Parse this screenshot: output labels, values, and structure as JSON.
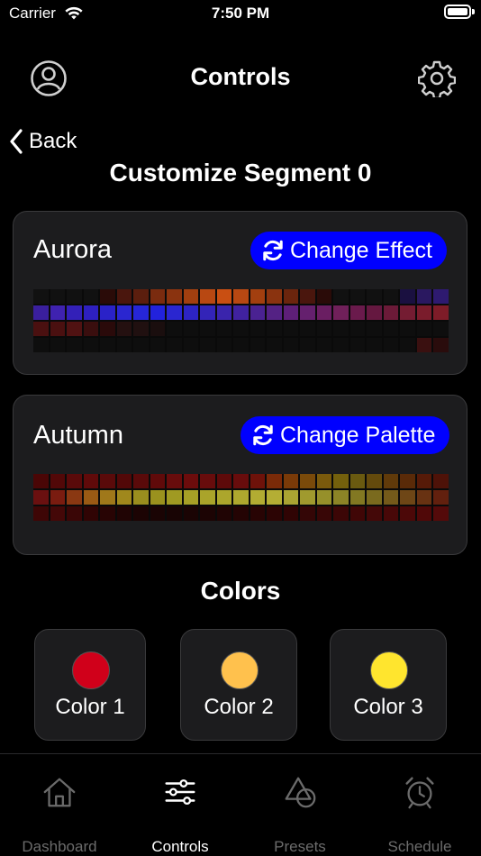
{
  "status": {
    "carrier": "Carrier",
    "time": "7:50 PM"
  },
  "nav": {
    "title": "Controls",
    "back_label": "Back"
  },
  "page": {
    "title": "Customize Segment 0"
  },
  "effect_card": {
    "name": "Aurora",
    "button_label": "Change Effect",
    "rows": [
      [
        "#111",
        "#111",
        "#111",
        "#111",
        "#2a0b08",
        "#4a160d",
        "#5b1e0e",
        "#7a2b0f",
        "#8a330f",
        "#a23f0f",
        "#b84812",
        "#c94f12",
        "#b84812",
        "#a23f0f",
        "#8a330f",
        "#6b250d",
        "#4a160d",
        "#2a0b08",
        "#111",
        "#111",
        "#111",
        "#111",
        "#1a1040",
        "#2a1860",
        "#2e1a70"
      ],
      [
        "#3a1f9e",
        "#3f22b0",
        "#3320b8",
        "#2e20c0",
        "#2a22c8",
        "#2a26d0",
        "#2626d8",
        "#2222dc",
        "#2a26d0",
        "#2d24c4",
        "#3324b8",
        "#3a24ac",
        "#4022a0",
        "#4a2292",
        "#542284",
        "#5e1f78",
        "#65206e",
        "#6a1e62",
        "#70205a",
        "#6a1a4c",
        "#651840",
        "#6b1a38",
        "#741c32",
        "#7a1c2c",
        "#7e1c28"
      ],
      [
        "#4a1010",
        "#4a1010",
        "#501212",
        "#3a0e0e",
        "#2a0a0a",
        "#241010",
        "#201010",
        "#1a0e0e",
        "#0e0e0e",
        "#0e0e0e",
        "#0e0e0e",
        "#0e0e0e",
        "#0e0e0e",
        "#0e0e0e",
        "#0e0e0e",
        "#0e0e0e",
        "#0e0e0e",
        "#0e0e0e",
        "#0e0e0e",
        "#0e0e0e",
        "#0e0e0e",
        "#0e0e0e",
        "#0e0e0e",
        "#0e0e0e",
        "#0e0e0e"
      ],
      [
        "#0e0e0e",
        "#0e0e0e",
        "#0e0e0e",
        "#0e0e0e",
        "#0e0e0e",
        "#0e0e0e",
        "#0e0e0e",
        "#0e0e0e",
        "#0e0e0e",
        "#0e0e0e",
        "#0e0e0e",
        "#0e0e0e",
        "#0e0e0e",
        "#0e0e0e",
        "#0e0e0e",
        "#0e0e0e",
        "#0e0e0e",
        "#0e0e0e",
        "#0e0e0e",
        "#0e0e0e",
        "#0e0e0e",
        "#0e0e0e",
        "#0e0e0e",
        "#3a1010",
        "#2a0c0c"
      ]
    ]
  },
  "palette_card": {
    "name": "Autumn",
    "button_label": "Change Palette",
    "rows": [
      [
        "#4a0606",
        "#520808",
        "#5a0a0a",
        "#600a0a",
        "#5a0a0a",
        "#520808",
        "#5a0a0a",
        "#600a0a",
        "#680c0c",
        "#6c0c0c",
        "#680c0c",
        "#5e0a0a",
        "#680c0c",
        "#6e120a",
        "#7a2a08",
        "#7a3a08",
        "#7a4a0a",
        "#7a5a0c",
        "#74600c",
        "#6a5a10",
        "#644a0c",
        "#603a0a",
        "#5a2a08",
        "#561a08",
        "#4e1208"
      ],
      [
        "#6a1010",
        "#7a1c10",
        "#8a3812",
        "#9a5a14",
        "#a0781a",
        "#a0881c",
        "#9a8e1e",
        "#9a921e",
        "#a09a22",
        "#a6a026",
        "#aaa42a",
        "#aca62c",
        "#aea82e",
        "#b2ac32",
        "#b4ae34",
        "#aaa432",
        "#a09a2e",
        "#96902a",
        "#8c8426",
        "#827822",
        "#7a6a1e",
        "#745a1a",
        "#6e4616",
        "#683212",
        "#62200e"
      ],
      [
        "#3e0606",
        "#440808",
        "#3a0606",
        "#300404",
        "#280404",
        "#200404",
        "#1c0404",
        "#1a0404",
        "#180404",
        "#1a0404",
        "#1c0404",
        "#200404",
        "#240404",
        "#280404",
        "#2c0404",
        "#300404",
        "#340606",
        "#380606",
        "#3c0606",
        "#400606",
        "#440808",
        "#480808",
        "#4c0808",
        "#500808",
        "#540a0a"
      ]
    ]
  },
  "colors_section": {
    "title": "Colors",
    "items": [
      {
        "label": "Color 1",
        "hex": "#d0001a"
      },
      {
        "label": "Color 2",
        "hex": "#ffc14d"
      },
      {
        "label": "Color 3",
        "hex": "#ffe52e"
      }
    ]
  },
  "tabs": [
    {
      "label": "Dashboard",
      "icon": "house-icon",
      "active": false
    },
    {
      "label": "Controls",
      "icon": "sliders-icon",
      "active": true
    },
    {
      "label": "Presets",
      "icon": "shapes-icon",
      "active": false
    },
    {
      "label": "Schedule",
      "icon": "alarm-clock-icon",
      "active": false
    }
  ],
  "accent_color": "#0000ff"
}
